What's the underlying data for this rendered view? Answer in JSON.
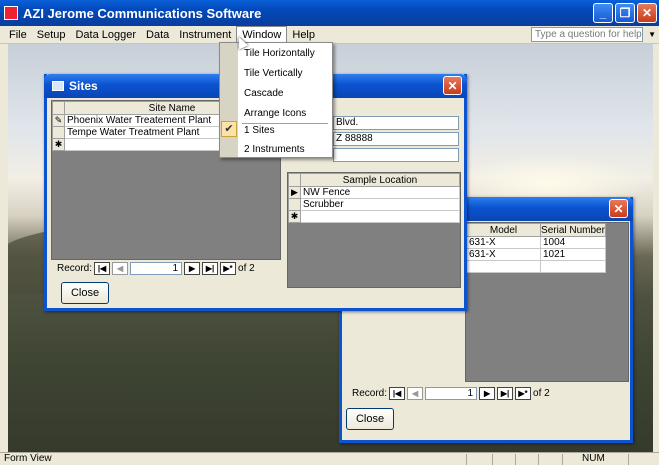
{
  "app": {
    "title": "AZI Jerome Communications Software",
    "help_placeholder": "Type a question for help"
  },
  "menu": [
    "File",
    "Setup",
    "Data Logger",
    "Data",
    "Instrument",
    "Window",
    "Help"
  ],
  "window_menu": {
    "items": [
      "Tile Horizontally",
      "Tile Vertically",
      "Cascade",
      "Arrange Icons",
      "1 Sites",
      "2 Instruments"
    ],
    "checked_item": "1 Sites"
  },
  "sites": {
    "title": "Sites",
    "column_header": "Site Name",
    "rows": [
      "Phoenix Water Treatement Plant",
      "Tempe Water Treatment Plant"
    ],
    "detail_line1": "Blvd.",
    "detail_line2": "Z 88888",
    "sample_header": "Sample Location",
    "sample_rows": [
      "NW Fence",
      "Scrubber"
    ],
    "record_label": "Record:",
    "record_current": "1",
    "record_total": "of  2",
    "close_label": "Close"
  },
  "instruments": {
    "headers": [
      "Model",
      "Serial Number"
    ],
    "rows": [
      [
        "631-X",
        "1004"
      ],
      [
        "631-X",
        "1021"
      ]
    ],
    "record_label": "Record:",
    "record_current": "1",
    "record_total": "of  2",
    "close_label": "Close"
  },
  "status": {
    "left": "Form View",
    "right": "NUM"
  },
  "colors": {
    "title_blue": "#0b53cf",
    "close_red": "#c83c1a",
    "menu_bg": "#ece9d8"
  }
}
